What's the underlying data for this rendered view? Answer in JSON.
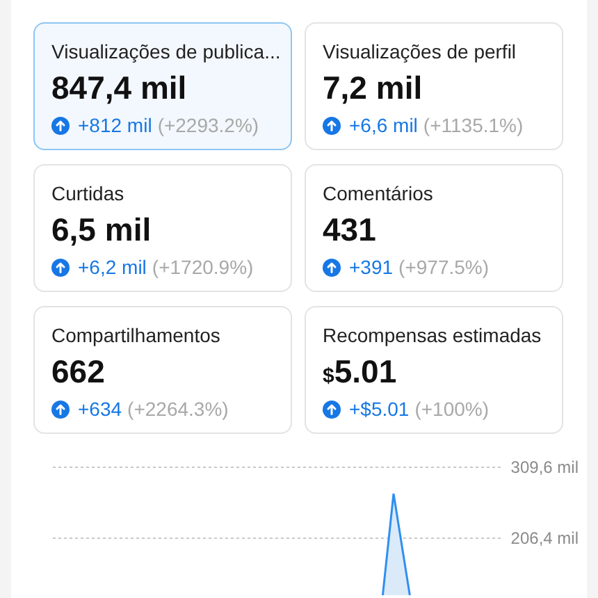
{
  "metrics": [
    {
      "title": "Visualizações de publica...",
      "value": "847,4 mil",
      "change": "+812 mil",
      "percent": "(+2293.2%)",
      "selected": true
    },
    {
      "title": "Visualizações de perfil",
      "value": "7,2 mil",
      "change": "+6,6 mil",
      "percent": "(+1135.1%)",
      "selected": false
    },
    {
      "title": "Curtidas",
      "value": "6,5 mil",
      "change": "+6,2 mil",
      "percent": "(+1720.9%)",
      "selected": false
    },
    {
      "title": "Comentários",
      "value": "431",
      "change": "+391",
      "percent": "(+977.5%)",
      "selected": false
    },
    {
      "title": "Compartilhamentos",
      "value": "662",
      "change": "+634",
      "percent": "(+2264.3%)",
      "selected": false
    },
    {
      "title": "Recompensas estimadas",
      "currency": "$",
      "value": "5.01",
      "change": "+$5.01",
      "percent": "(+100%)",
      "selected": false
    }
  ],
  "chart": {
    "ticks": [
      "309,6 mil",
      "206,4 mil"
    ]
  }
}
